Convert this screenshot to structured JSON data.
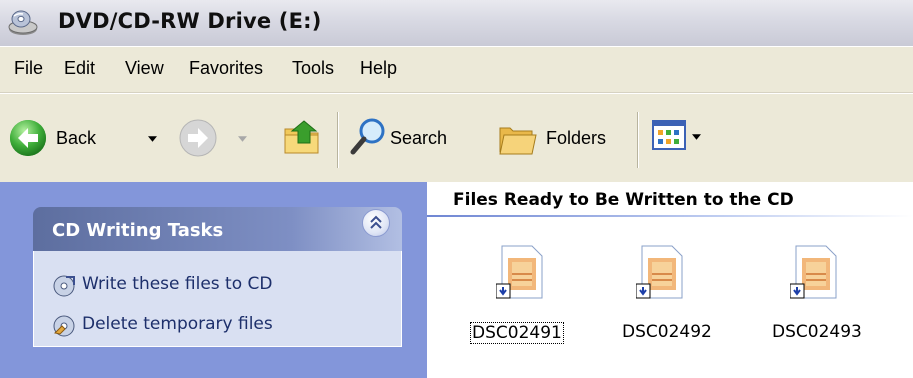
{
  "window": {
    "title": "DVD/CD-RW Drive (E:)",
    "title_icon": "cd-drive-icon"
  },
  "menu": {
    "items": [
      "File",
      "Edit",
      "View",
      "Favorites",
      "Tools",
      "Help"
    ]
  },
  "toolbar": {
    "back_label": "Back",
    "search_label": "Search",
    "folders_label": "Folders",
    "icons": [
      "back-arrow-icon",
      "dropdown-arrow-icon",
      "forward-arrow-icon",
      "up-folder-icon",
      "magnifier-icon",
      "folders-icon",
      "views-icon"
    ]
  },
  "tasks": {
    "group_title": "CD Writing Tasks",
    "items": [
      {
        "label": "Write these files to CD",
        "icon": "cd-write-icon"
      },
      {
        "label": "Delete temporary files",
        "icon": "cd-delete-icon"
      }
    ]
  },
  "content": {
    "header": "Files Ready to Be Written to the CD",
    "files": [
      {
        "name": "DSC02491",
        "selected": true,
        "icon": "jpeg-pending-icon"
      },
      {
        "name": "DSC02492",
        "selected": false,
        "icon": "jpeg-pending-icon"
      },
      {
        "name": "DSC02493",
        "selected": false,
        "icon": "jpeg-pending-icon"
      }
    ]
  },
  "colors": {
    "pane_blue": "#7b92df",
    "task_text": "#1d2f6b",
    "toolbar_bg": "#ece9d8"
  }
}
